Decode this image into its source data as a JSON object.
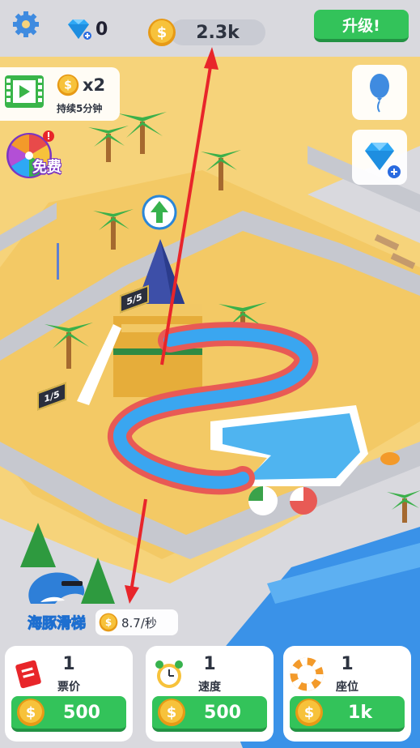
{
  "hud": {
    "gems": "0",
    "coins": "2.3k",
    "upgrade_label": "升级!"
  },
  "boost": {
    "multiplier": "x2",
    "duration": "持续5分钟"
  },
  "wheel": {
    "free_label": "免费"
  },
  "attraction": {
    "tower_capacity": "5/5",
    "queue_capacity": "1/5",
    "logo_text": "海豚滑梯",
    "income": "8.7/秒"
  },
  "upgrades": [
    {
      "level": "1",
      "name": "票价",
      "price": "500",
      "icon": "ticket-icon"
    },
    {
      "level": "1",
      "name": "速度",
      "price": "500",
      "icon": "alarm-clock-icon"
    },
    {
      "level": "1",
      "name": "座位",
      "price": "1k",
      "icon": "swim-ring-icon"
    }
  ],
  "colors": {
    "green_button": "#33c35a",
    "sand": "#f6d37a",
    "water": "#3aa6f0",
    "slide": "#e85a55",
    "path": "#c6c8cf"
  }
}
